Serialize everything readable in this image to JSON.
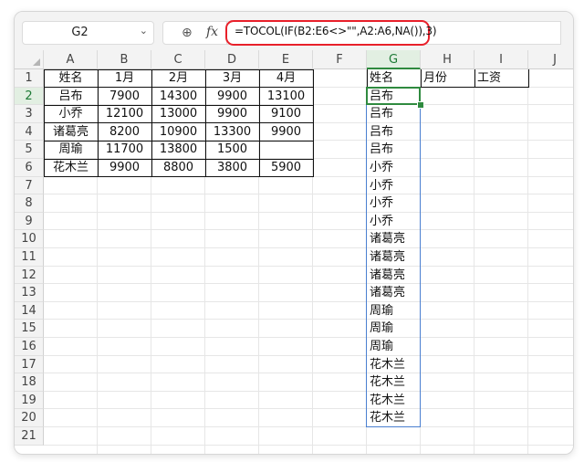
{
  "toolbar": {
    "name_box": "G2",
    "formula": "=TOCOL(IF(B2:E6<>\"\",A2:A6,NA()),3)"
  },
  "columns": [
    "A",
    "B",
    "C",
    "D",
    "E",
    "F",
    "G",
    "H",
    "I",
    "J"
  ],
  "rows": [
    "1",
    "2",
    "3",
    "4",
    "5",
    "6",
    "7",
    "8",
    "9",
    "10",
    "11",
    "12",
    "13",
    "14",
    "15",
    "16",
    "17",
    "18",
    "19",
    "20",
    "21"
  ],
  "table": {
    "headers": [
      "姓名",
      "1月",
      "2月",
      "3月",
      "4月"
    ],
    "rows": [
      [
        "吕布",
        "7900",
        "14300",
        "9900",
        "13100"
      ],
      [
        "小乔",
        "12100",
        "13000",
        "9900",
        "9100"
      ],
      [
        "诸葛亮",
        "8200",
        "10900",
        "13300",
        "9900"
      ],
      [
        "周瑜",
        "11700",
        "13800",
        "1500",
        ""
      ],
      [
        "花木兰",
        "9900",
        "8800",
        "3800",
        "5900"
      ]
    ]
  },
  "output": {
    "headers": [
      "姓名",
      "月份",
      "工资"
    ],
    "names": [
      "吕布",
      "吕布",
      "吕布",
      "吕布",
      "小乔",
      "小乔",
      "小乔",
      "小乔",
      "诸葛亮",
      "诸葛亮",
      "诸葛亮",
      "诸葛亮",
      "周瑜",
      "周瑜",
      "周瑜",
      "花木兰",
      "花木兰",
      "花木兰",
      "花木兰"
    ]
  }
}
